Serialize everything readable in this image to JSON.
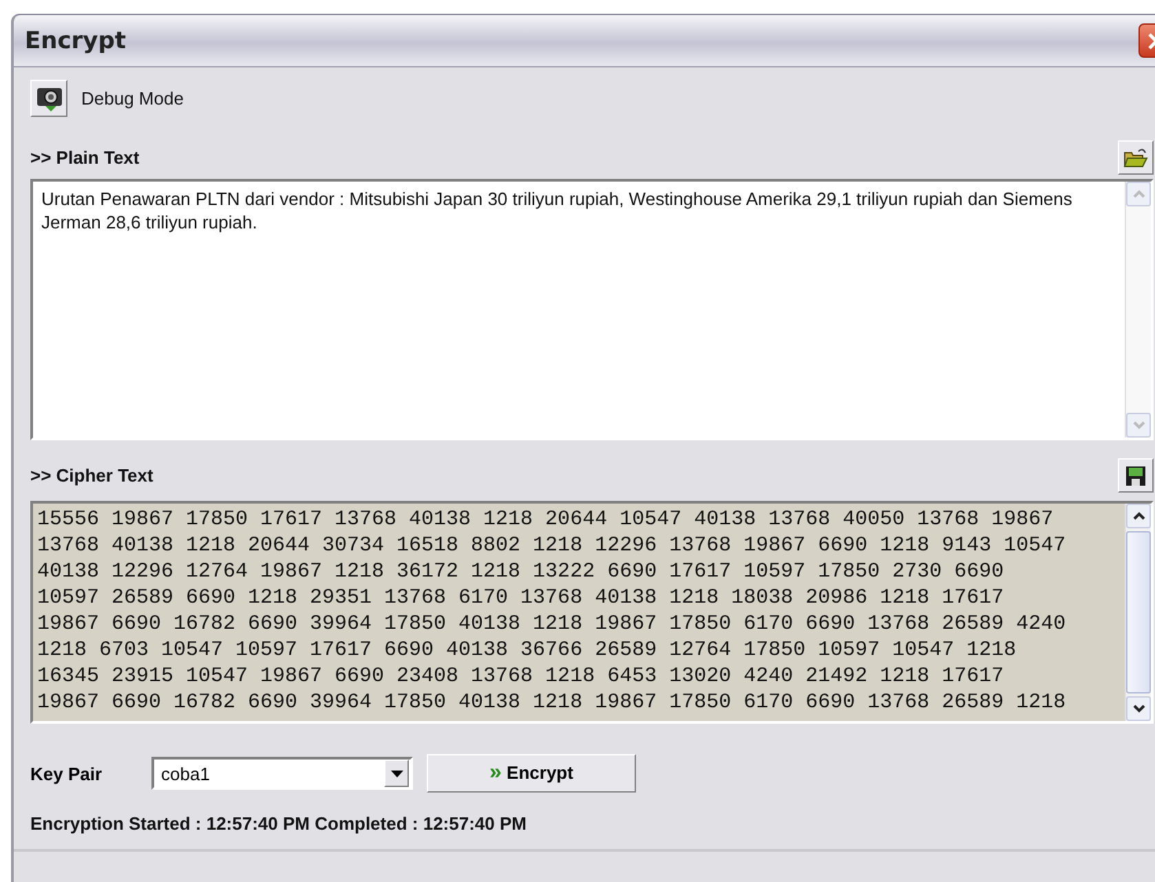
{
  "window": {
    "title": "Encrypt"
  },
  "debug_button": {
    "label": "Debug Mode"
  },
  "plain_text": {
    "label": ">> Plain Text",
    "value": "Urutan Penawaran PLTN dari vendor : Mitsubishi Japan 30 triliyun rupiah, Westinghouse Amerika 29,1 triliyun rupiah dan Siemens Jerman 28,6 triliyun rupiah."
  },
  "cipher_text": {
    "label": ">> Cipher Text",
    "lines": [
      "15556 19867 17850 17617 13768 40138 1218 20644 10547 40138 13768 40050 13768 19867",
      "13768 40138 1218 20644 30734 16518 8802 1218 12296 13768 19867 6690 1218 9143 10547",
      "40138 12296 12764 19867 1218 36172 1218 13222 6690 17617 10597 17850 2730 6690",
      "10597 26589 6690 1218 29351 13768 6170 13768 40138 1218 18038 20986 1218 17617",
      "19867 6690 16782 6690 39964 17850 40138 1218 19867 17850 6170 6690 13768 26589 4240",
      "1218 6703 10547 10597 17617 6690 40138 36766 26589 12764 17850 10597 10547 1218",
      "16345 23915 10547 19867 6690 23408 13768 1218 6453 13020 4240 21492 1218 17617",
      "19867 6690 16782 6690 39964 17850 40138 1218 19867 17850 6170 6690 13768 26589 1218"
    ]
  },
  "key_pair": {
    "label": "Key Pair",
    "value": "coba1"
  },
  "encrypt_button": {
    "icon": "»",
    "label": "Encrypt"
  },
  "status": "Encryption Started : 12:57:40 PM Completed : 12:57:40 PM"
}
